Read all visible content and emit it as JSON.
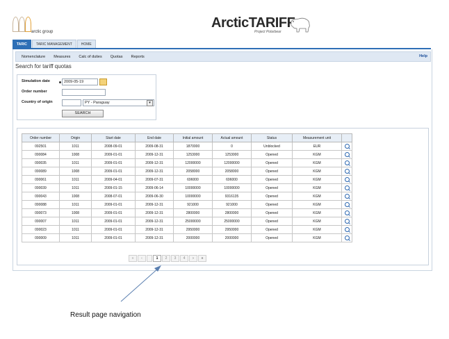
{
  "logo": {
    "text": "arctic group"
  },
  "brand": {
    "title": "ArcticTARIFF",
    "subtitle": "Project Polarbear"
  },
  "tabs": [
    {
      "label": "TARIC",
      "active": true
    },
    {
      "label": "TARIC MANAGEMENT",
      "active": false
    },
    {
      "label": "HOME",
      "active": false
    }
  ],
  "menu": {
    "items": [
      "Nomenclature",
      "Measures",
      "Calc of duties",
      "Quotas",
      "Reports"
    ],
    "help": "Help"
  },
  "page_title": "Search for tariff quotas",
  "search_form": {
    "simulation_date_label": "Simulation date",
    "simulation_date_value": "2009-05-19",
    "order_number_label": "Order number",
    "order_number_value": "",
    "country_label": "Country of origin",
    "country_code_value": "",
    "country_select_value": "PY - Paraguay",
    "search_button": "SEARCH"
  },
  "results": {
    "columns": [
      "Order number",
      "Origin",
      "Start date",
      "End date",
      "Initial amount",
      "Actual amount",
      "Status",
      "Measurement unit",
      ""
    ],
    "rows": [
      [
        "092501",
        "1011",
        "2008-09-01",
        "2009-08-31",
        "1870000",
        "0",
        "Unblocked",
        "EUR"
      ],
      [
        "090084",
        "1008",
        "2009-01-01",
        "2009-12-31",
        "1253000",
        "1253000",
        "Opened",
        "KGM"
      ],
      [
        "090035",
        "1011",
        "2009-01-01",
        "2009-12-31",
        "12000000",
        "12000000",
        "Opened",
        "KGM"
      ],
      [
        "090089",
        "1008",
        "2009-01-01",
        "2009-12-31",
        "2058000",
        "2058000",
        "Opened",
        "KGM"
      ],
      [
        "090061",
        "1011",
        "2009-04-01",
        "2009-07-31",
        "696000",
        "696000",
        "Opened",
        "KGM"
      ],
      [
        "090039",
        "1011",
        "2009-01-15",
        "2009-06-14",
        "10000000",
        "10000000",
        "Opened",
        "KGM"
      ],
      [
        "090043",
        "1008",
        "2008-07-01",
        "2009-06-30",
        "10000000",
        "9316135",
        "Opened",
        "KGM"
      ],
      [
        "090088",
        "1011",
        "2009-01-01",
        "2009-12-31",
        "921000",
        "921000",
        "Opened",
        "KGM"
      ],
      [
        "090073",
        "1008",
        "2009-01-01",
        "2009-12-31",
        "2800000",
        "2800000",
        "Opened",
        "KGM"
      ],
      [
        "090007",
        "1011",
        "2009-01-01",
        "2009-12-31",
        "25000000",
        "25000000",
        "Opened",
        "KGM"
      ],
      [
        "090023",
        "1011",
        "2009-01-01",
        "2009-12-31",
        "2950000",
        "2950000",
        "Opened",
        "KGM"
      ],
      [
        "090009",
        "1011",
        "2009-01-01",
        "2009-12-31",
        "2000000",
        "2000000",
        "Opened",
        "KGM"
      ]
    ],
    "row_icon": "magnifier-icon"
  },
  "pager": {
    "first": "«",
    "prev": "‹",
    "pages": [
      "1",
      "2",
      "3",
      "4"
    ],
    "current_page": "1",
    "next": "›",
    "last": "»"
  },
  "annotation": "Result page navigation",
  "colors": {
    "accent": "#2e6fb6",
    "menu_bg": "#dfe8f3",
    "header_bg": "#e7eef6",
    "arrow": "#5a7fb0"
  }
}
